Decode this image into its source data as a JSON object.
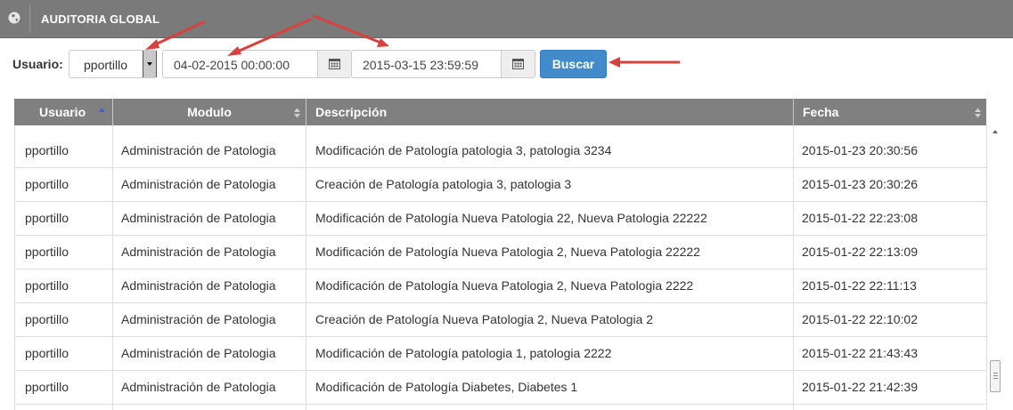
{
  "header": {
    "title": "AUDITORIA GLOBAL",
    "icon": "globe-icon"
  },
  "filters": {
    "user_label": "Usuario:",
    "user_selected": "pportillo",
    "date_from": "04-02-2015 00:00:00",
    "date_to": "2015-03-15 23:59:59",
    "search_label": "Buscar"
  },
  "table": {
    "headers": {
      "usuario": "Usuario",
      "modulo": "Modulo",
      "descripcion": "Descripción",
      "fecha": "Fecha"
    },
    "rows": [
      {
        "usuario": "pportillo",
        "modulo": "Administración de Patologia",
        "descripcion": "Modificación de Patología patologia 3, patologia 3234",
        "fecha": "2015-01-23 20:30:56"
      },
      {
        "usuario": "pportillo",
        "modulo": "Administración de Patologia",
        "descripcion": "Creación de Patología patologia 3, patologia 3",
        "fecha": "2015-01-23 20:30:26"
      },
      {
        "usuario": "pportillo",
        "modulo": "Administración de Patologia",
        "descripcion": "Modificación de Patología Nueva Patologia 22, Nueva Patologia 22222",
        "fecha": "2015-01-22 22:23:08"
      },
      {
        "usuario": "pportillo",
        "modulo": "Administración de Patologia",
        "descripcion": "Modificación de Patología Nueva Patologia 2, Nueva Patologia 22222",
        "fecha": "2015-01-22 22:13:09"
      },
      {
        "usuario": "pportillo",
        "modulo": "Administración de Patologia",
        "descripcion": "Modificación de Patología Nueva Patologia 2, Nueva Patologia 2222",
        "fecha": "2015-01-22 22:11:13"
      },
      {
        "usuario": "pportillo",
        "modulo": "Administración de Patologia",
        "descripcion": "Creación de Patología Nueva Patologia 2, Nueva Patologia 2",
        "fecha": "2015-01-22 22:10:02"
      },
      {
        "usuario": "pportillo",
        "modulo": "Administración de Patologia",
        "descripcion": "Modificación de Patología patologia 1, patologia 2222",
        "fecha": "2015-01-22 21:43:43"
      },
      {
        "usuario": "pportillo",
        "modulo": "Administración de Patologia",
        "descripcion": "Modificación de Patología Diabetes, Diabetes 1",
        "fecha": "2015-01-22 21:42:39"
      }
    ]
  },
  "colors": {
    "accent": "#428bca",
    "header_bg": "#7a7a7a",
    "annotation_arrow": "#d9413e"
  }
}
